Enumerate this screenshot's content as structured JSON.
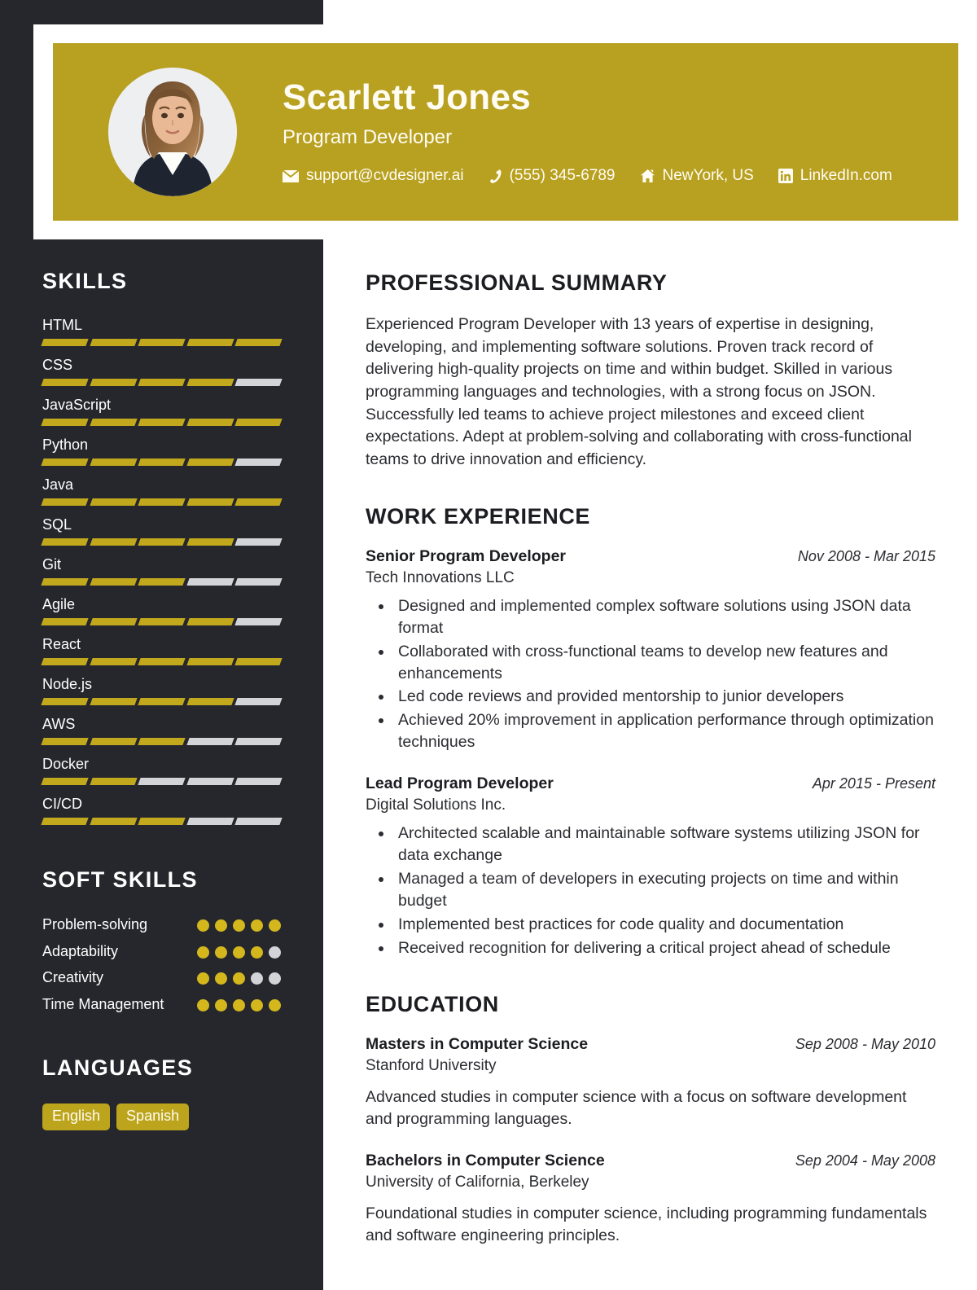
{
  "theme": {
    "gold": "#b8a021",
    "gold_bar": "#c1a81c",
    "dark_sidebar": "#26272d",
    "empty_bar": "#d3d4d8",
    "text_dark": "#2b2c31"
  },
  "header": {
    "name": "Scarlett Jones",
    "role": "Program Developer",
    "avatar_alt": "profile-photo",
    "contacts": [
      {
        "icon": "envelope-icon",
        "text": "support@cvdesigner.ai"
      },
      {
        "icon": "phone-icon",
        "text": "(555) 345-6789"
      },
      {
        "icon": "home-icon",
        "text": "NewYork, US"
      },
      {
        "icon": "linkedin-icon",
        "text": "LinkedIn.com"
      }
    ]
  },
  "sidebar": {
    "skills_heading": "SKILLS",
    "skills_max": 5,
    "skills": [
      {
        "name": "HTML",
        "level": 5
      },
      {
        "name": "CSS",
        "level": 4
      },
      {
        "name": "JavaScript",
        "level": 5
      },
      {
        "name": "Python",
        "level": 4
      },
      {
        "name": "Java",
        "level": 5
      },
      {
        "name": "SQL",
        "level": 4
      },
      {
        "name": "Git",
        "level": 3
      },
      {
        "name": "Agile",
        "level": 4
      },
      {
        "name": "React",
        "level": 5
      },
      {
        "name": "Node.js",
        "level": 4
      },
      {
        "name": "AWS",
        "level": 3
      },
      {
        "name": "Docker",
        "level": 2
      },
      {
        "name": "CI/CD",
        "level": 3
      }
    ],
    "soft_skills_heading": "SOFT SKILLS",
    "soft_skills_max": 5,
    "soft_skills": [
      {
        "name": "Problem-solving",
        "level": 5
      },
      {
        "name": "Adaptability",
        "level": 4
      },
      {
        "name": "Creativity",
        "level": 3
      },
      {
        "name": "Time Management",
        "level": 5
      }
    ],
    "languages_heading": "LANGUAGES",
    "languages": [
      "English",
      "Spanish"
    ]
  },
  "main": {
    "summary_heading": "PROFESSIONAL SUMMARY",
    "summary": "Experienced Program Developer with 13 years of expertise in designing, developing, and implementing software solutions. Proven track record of delivering high-quality projects on time and within budget. Skilled in various programming languages and technologies, with a strong focus on JSON. Successfully led teams to achieve project milestones and exceed client expectations. Adept at problem-solving and collaborating with cross-functional teams to drive innovation and efficiency.",
    "work_heading": "WORK EXPERIENCE",
    "work": [
      {
        "title": "Senior Program Developer",
        "date": "Nov 2008 - Mar 2015",
        "org": "Tech Innovations LLC",
        "bullets": [
          "Designed and implemented complex software solutions using JSON data format",
          "Collaborated with cross-functional teams to develop new features and enhancements",
          "Led code reviews and provided mentorship to junior developers",
          "Achieved 20% improvement in application performance through optimization techniques"
        ]
      },
      {
        "title": "Lead Program Developer",
        "date": "Apr 2015 - Present",
        "org": "Digital Solutions Inc.",
        "bullets": [
          "Architected scalable and maintainable software systems utilizing JSON for data exchange",
          "Managed a team of developers in executing projects on time and within budget",
          "Implemented best practices for code quality and documentation",
          "Received recognition for delivering a critical project ahead of schedule"
        ]
      }
    ],
    "education_heading": "EDUCATION",
    "education": [
      {
        "degree": "Masters in Computer Science",
        "date": "Sep 2008 - May 2010",
        "school": "Stanford University",
        "description": "Advanced studies in computer science with a focus on software development and programming languages."
      },
      {
        "degree": "Bachelors in Computer Science",
        "date": "Sep 2004 - May 2008",
        "school": "University of California, Berkeley",
        "description": "Foundational studies in computer science, including programming fundamentals and software engineering principles."
      }
    ]
  }
}
